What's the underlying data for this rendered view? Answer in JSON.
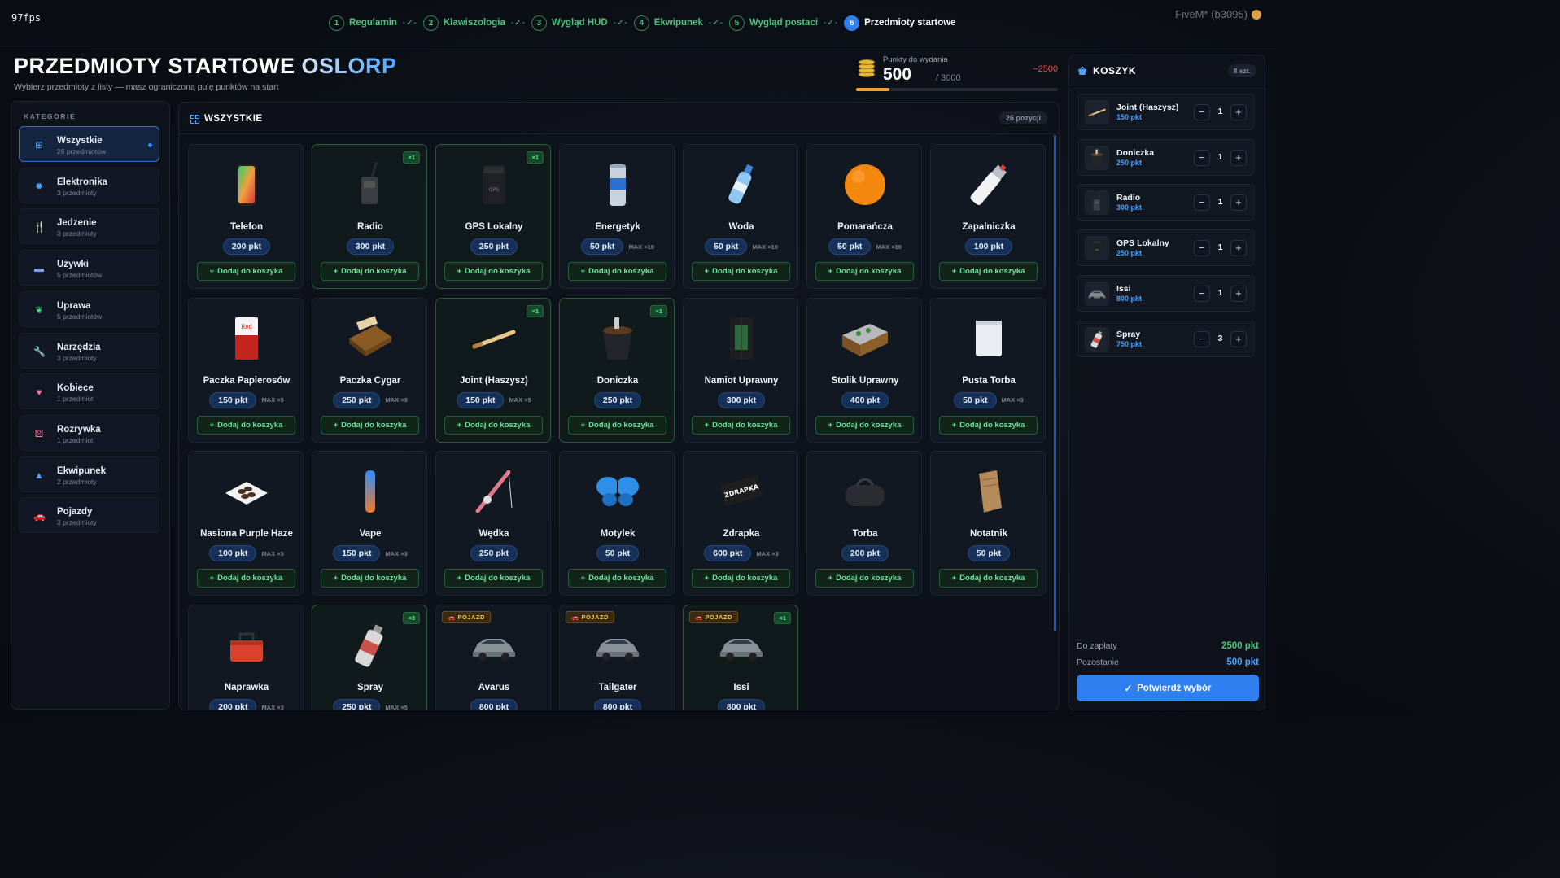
{
  "overlay": {
    "fps": "97fps",
    "platform": "FiveM* (b3095)"
  },
  "steps": [
    {
      "num": "1",
      "label": "Regulamin"
    },
    {
      "num": "2",
      "label": "Klawiszologia"
    },
    {
      "num": "3",
      "label": "Wygląd HUD"
    },
    {
      "num": "4",
      "label": "Ekwipunek"
    },
    {
      "num": "5",
      "label": "Wygląd postaci"
    },
    {
      "num": "6",
      "label": "Przedmioty startowe"
    }
  ],
  "header": {
    "title": "PRZEDMIOTY STARTOWE",
    "brand": "OSLORP",
    "subtitle": "Wybierz przedmioty z listy — masz ograniczoną pulę punktów na start"
  },
  "points": {
    "label": "Punkty do wydania",
    "value": "500",
    "max": "/ 3000",
    "delta": "−2500",
    "fill_fraction": 0.1667
  },
  "sidebar": {
    "heading": "KATEGORIE",
    "categories": [
      {
        "name": "Wszystkie",
        "count": "26 przedmiotów",
        "icon": "grid-icon"
      },
      {
        "name": "Elektronika",
        "count": "3 przedmioty",
        "icon": "chip-icon"
      },
      {
        "name": "Jedzenie",
        "count": "3 przedmioty",
        "icon": "cutlery-icon"
      },
      {
        "name": "Używki",
        "count": "5 przedmiotów",
        "icon": "cigarette-icon"
      },
      {
        "name": "Uprawa",
        "count": "5 przedmiotów",
        "icon": "seedling-icon"
      },
      {
        "name": "Narzędzia",
        "count": "3 przedmioty",
        "icon": "wrench-icon"
      },
      {
        "name": "Kobiece",
        "count": "1 przedmiot",
        "icon": "heart-icon"
      },
      {
        "name": "Rozrywka",
        "count": "1 przedmiot",
        "icon": "dice-icon"
      },
      {
        "name": "Ekwipunek",
        "count": "2 przedmioty",
        "icon": "bag-icon"
      },
      {
        "name": "Pojazdy",
        "count": "3 przedmioty",
        "icon": "car-icon"
      }
    ]
  },
  "grid": {
    "heading": "WSZYSTKIE",
    "count": "26 pozycji",
    "add_label": "Dodaj do koszyka",
    "items": [
      {
        "name": "Telefon",
        "price": "200 pkt",
        "max": "",
        "badge": "",
        "vehicle": "",
        "icon": "phone-icon"
      },
      {
        "name": "Radio",
        "price": "300 pkt",
        "max": "",
        "badge": "×1",
        "vehicle": "",
        "icon": "radio-icon"
      },
      {
        "name": "GPS Lokalny",
        "price": "250 pkt",
        "max": "",
        "badge": "×1",
        "vehicle": "",
        "icon": "gps-icon"
      },
      {
        "name": "Energetyk",
        "price": "50 pkt",
        "max": "MAX ×10",
        "badge": "",
        "vehicle": "",
        "icon": "can-icon"
      },
      {
        "name": "Woda",
        "price": "50 pkt",
        "max": "MAX ×10",
        "badge": "",
        "vehicle": "",
        "icon": "bottle-icon"
      },
      {
        "name": "Pomarańcza",
        "price": "50 pkt",
        "max": "MAX ×10",
        "badge": "",
        "vehicle": "",
        "icon": "orange-icon"
      },
      {
        "name": "Zapalniczka",
        "price": "100 pkt",
        "max": "",
        "badge": "",
        "vehicle": "",
        "icon": "lighter-icon"
      },
      {
        "name": "Paczka Papierosów",
        "price": "150 pkt",
        "max": "MAX ×5",
        "badge": "",
        "vehicle": "",
        "icon": "cigarette-pack-icon"
      },
      {
        "name": "Paczka Cygar",
        "price": "250 pkt",
        "max": "MAX ×3",
        "badge": "",
        "vehicle": "",
        "icon": "cigar-box-icon"
      },
      {
        "name": "Joint (Haszysz)",
        "price": "150 pkt",
        "max": "MAX ×5",
        "badge": "×1",
        "vehicle": "",
        "icon": "joint-icon"
      },
      {
        "name": "Doniczka",
        "price": "250 pkt",
        "max": "",
        "badge": "×1",
        "vehicle": "",
        "icon": "pot-icon"
      },
      {
        "name": "Namiot Uprawny",
        "price": "300 pkt",
        "max": "",
        "badge": "",
        "vehicle": "",
        "icon": "grow-tent-icon"
      },
      {
        "name": "Stolik Uprawny",
        "price": "400 pkt",
        "max": "",
        "badge": "",
        "vehicle": "",
        "icon": "grow-table-icon"
      },
      {
        "name": "Pusta Torba",
        "price": "50 pkt",
        "max": "MAX ×3",
        "badge": "",
        "vehicle": "",
        "icon": "baggie-icon"
      },
      {
        "name": "Nasiona Purple Haze",
        "price": "100 pkt",
        "max": "MAX ×5",
        "badge": "",
        "vehicle": "",
        "icon": "seeds-icon"
      },
      {
        "name": "Vape",
        "price": "150 pkt",
        "max": "MAX ×3",
        "badge": "",
        "vehicle": "",
        "icon": "vape-icon"
      },
      {
        "name": "Wędka",
        "price": "250 pkt",
        "max": "",
        "badge": "",
        "vehicle": "",
        "icon": "fishing-rod-icon"
      },
      {
        "name": "Motylek",
        "price": "50 pkt",
        "max": "",
        "badge": "",
        "vehicle": "",
        "icon": "butterfly-icon"
      },
      {
        "name": "Zdrapka",
        "price": "600 pkt",
        "max": "MAX ×3",
        "badge": "",
        "vehicle": "",
        "icon": "scratch-card-icon"
      },
      {
        "name": "Torba",
        "price": "200 pkt",
        "max": "",
        "badge": "",
        "vehicle": "",
        "icon": "duffel-bag-icon"
      },
      {
        "name": "Notatnik",
        "price": "50 pkt",
        "max": "",
        "badge": "",
        "vehicle": "",
        "icon": "notepad-icon"
      },
      {
        "name": "Naprawka",
        "price": "200 pkt",
        "max": "MAX ×3",
        "badge": "",
        "vehicle": "",
        "icon": "toolbox-icon"
      },
      {
        "name": "Spray",
        "price": "250 pkt",
        "max": "MAX ×5",
        "badge": "×3",
        "vehicle": "",
        "icon": "spray-can-icon"
      },
      {
        "name": "Avarus",
        "price": "800 pkt",
        "max": "",
        "badge": "",
        "vehicle": "POJAZD",
        "icon": "car-icon"
      },
      {
        "name": "Tailgater",
        "price": "800 pkt",
        "max": "",
        "badge": "",
        "vehicle": "POJAZD",
        "icon": "car-icon"
      },
      {
        "name": "Issi",
        "price": "800 pkt",
        "max": "",
        "badge": "×1",
        "vehicle": "POJAZD",
        "icon": "car-icon"
      }
    ]
  },
  "cart": {
    "heading": "KOSZYK",
    "count": "8 szt.",
    "items": [
      {
        "name": "Joint (Haszysz)",
        "price": "150 pkt",
        "qty": "1",
        "icon": "joint-icon"
      },
      {
        "name": "Doniczka",
        "price": "250 pkt",
        "qty": "1",
        "icon": "pot-icon"
      },
      {
        "name": "Radio",
        "price": "300 pkt",
        "qty": "1",
        "icon": "radio-icon"
      },
      {
        "name": "GPS Lokalny",
        "price": "250 pkt",
        "qty": "1",
        "icon": "gps-icon"
      },
      {
        "name": "Issi",
        "price": "800 pkt",
        "qty": "1",
        "icon": "car-icon"
      },
      {
        "name": "Spray",
        "price": "750 pkt",
        "qty": "3",
        "icon": "spray-can-icon"
      }
    ],
    "total_label": "Do zapłaty",
    "total_value": "2500 pkt",
    "remaining_label": "Pozostanie",
    "remaining_value": "500 pkt",
    "confirm_label": "Potwierdź wybór"
  },
  "colors": {
    "accent": "#2f7ff0",
    "success": "#4ec27a",
    "danger": "#e05050",
    "gold": "#f0a030"
  }
}
